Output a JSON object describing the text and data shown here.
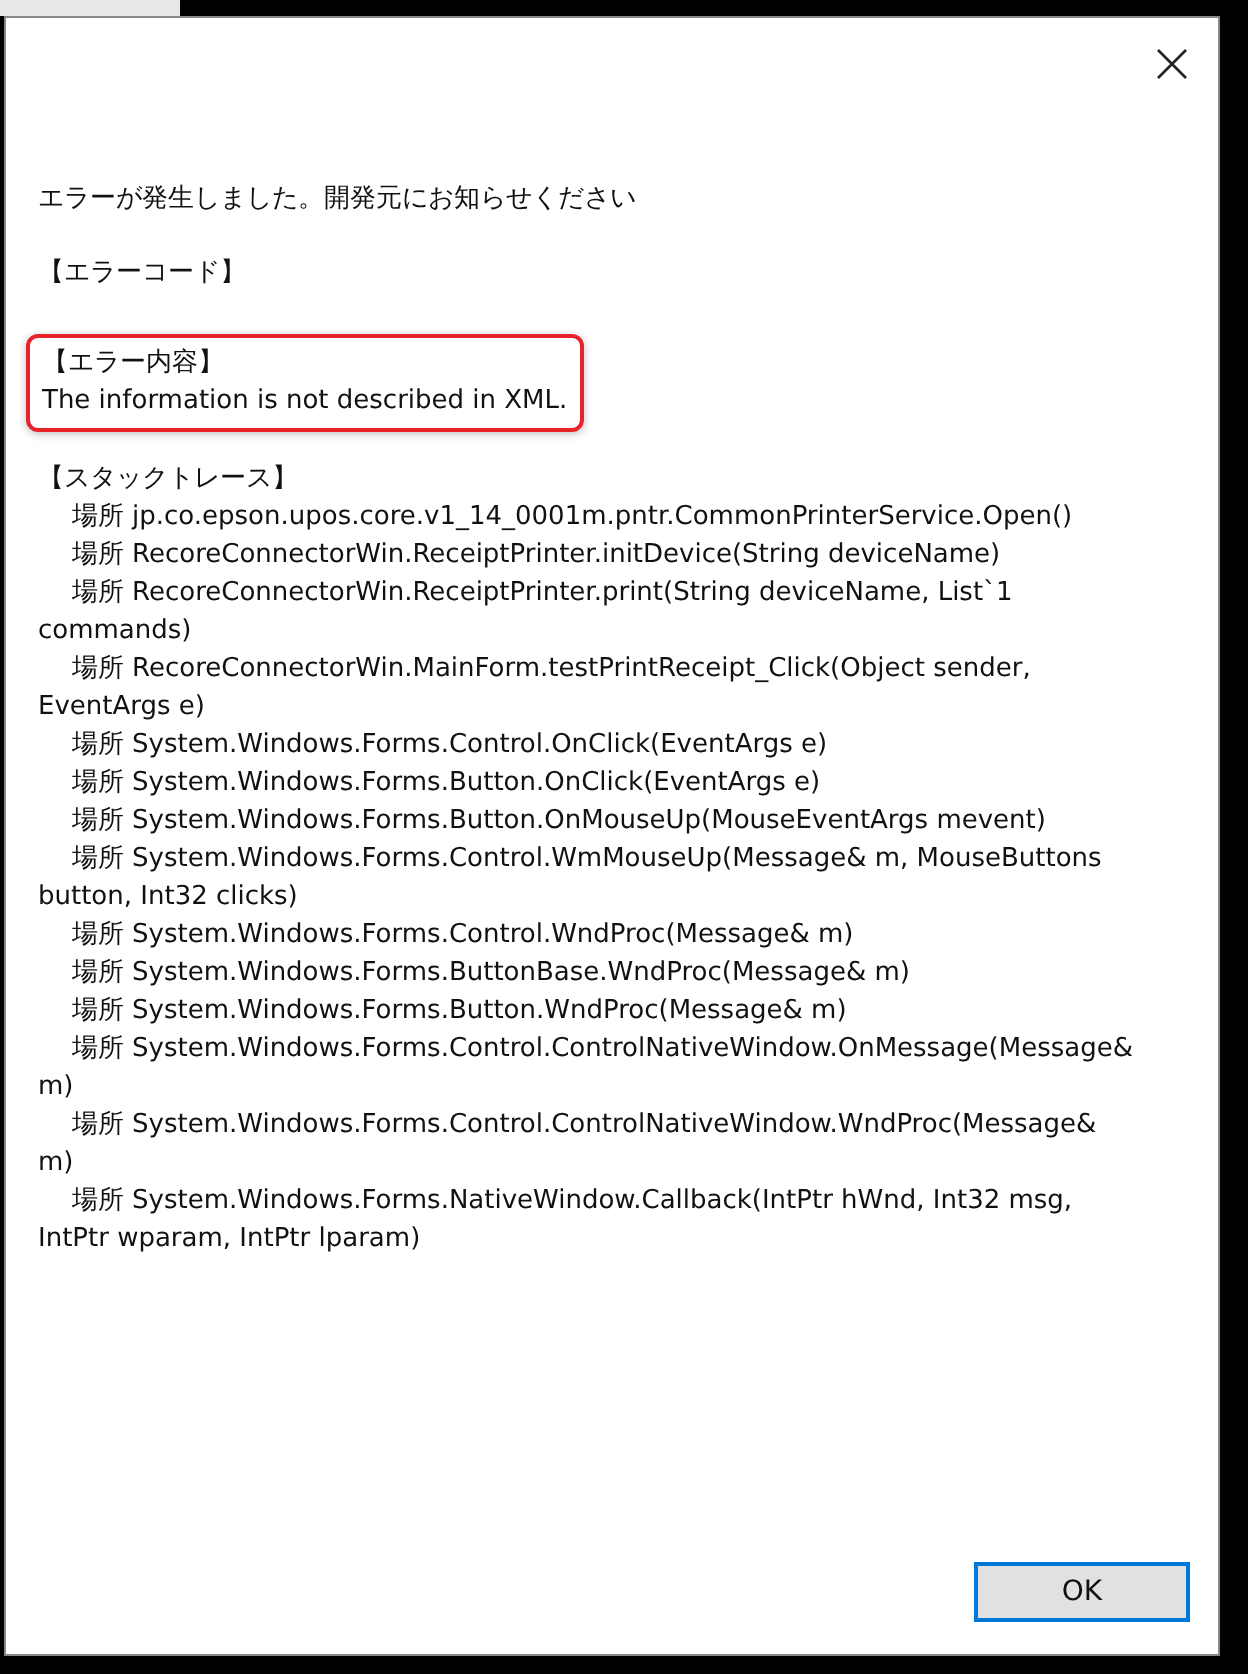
{
  "dialog": {
    "message": "エラーが発生しました。開発元にお知らせください",
    "error_code": {
      "heading": "【エラーコード】"
    },
    "error_content": {
      "heading": "【エラー内容】",
      "text": "The information is not described in XML.",
      "highlighted": true
    },
    "stack_trace": {
      "heading": "【スタックトレース】",
      "frames": [
        "場所 jp.co.epson.upos.core.v1_14_0001m.pntr.CommonPrinterService.Open()",
        "場所 RecoreConnectorWin.ReceiptPrinter.initDevice(String deviceName)",
        "場所 RecoreConnectorWin.ReceiptPrinter.print(String deviceName, List`1 commands)",
        "場所 RecoreConnectorWin.MainForm.testPrintReceipt_Click(Object sender, EventArgs e)",
        "場所 System.Windows.Forms.Control.OnClick(EventArgs e)",
        "場所 System.Windows.Forms.Button.OnClick(EventArgs e)",
        "場所 System.Windows.Forms.Button.OnMouseUp(MouseEventArgs mevent)",
        "場所 System.Windows.Forms.Control.WmMouseUp(Message& m, MouseButtons button, Int32 clicks)",
        "場所 System.Windows.Forms.Control.WndProc(Message& m)",
        "場所 System.Windows.Forms.ButtonBase.WndProc(Message& m)",
        "場所 System.Windows.Forms.Button.WndProc(Message& m)",
        "場所 System.Windows.Forms.Control.ControlNativeWindow.OnMessage(Message& m)",
        "場所 System.Windows.Forms.Control.ControlNativeWindow.WndProc(Message& m)",
        "場所 System.Windows.Forms.NativeWindow.Callback(IntPtr hWnd, Int32 msg, IntPtr wparam, IntPtr lparam)"
      ]
    },
    "buttons": [
      {
        "label": "OK",
        "focused": true
      }
    ]
  }
}
